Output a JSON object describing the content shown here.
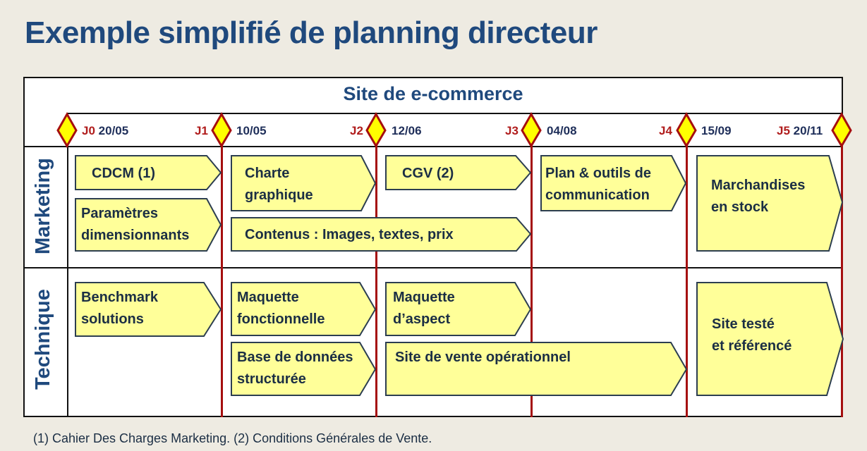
{
  "title": "Exemple simplifié de planning directeur",
  "project": "Site de e-commerce",
  "colors": {
    "title": "#1f497d",
    "milestone_fill": "#ffff00",
    "milestone_stroke": "#a50f0f",
    "task_fill": "#ffff99",
    "task_stroke": "#2c3e50",
    "milestone_line": "#a50f0f"
  },
  "milestones": [
    {
      "id": "J0",
      "date": "20/05"
    },
    {
      "id": "J1",
      "date": "10/05"
    },
    {
      "id": "J2",
      "date": "12/06"
    },
    {
      "id": "J3",
      "date": "04/08"
    },
    {
      "id": "J4",
      "date": "15/09"
    },
    {
      "id": "J5",
      "date": "20/11"
    }
  ],
  "lanes": [
    {
      "name": "Marketing",
      "tasks": [
        {
          "label": "CDCM (1)",
          "from": "J0",
          "to": "J1"
        },
        {
          "label": "Paramètres dimensionnants",
          "from": "J0",
          "to": "J1"
        },
        {
          "label": "Charte graphique",
          "from": "J1",
          "to": "J2"
        },
        {
          "label": "Contenus : Images, textes, prix",
          "from": "J1",
          "to": "J3"
        },
        {
          "label": "CGV (2)",
          "from": "J2",
          "to": "J3"
        },
        {
          "label": "Plan & outils de communication",
          "from": "J3",
          "to": "J4"
        },
        {
          "label": "Marchandises en stock",
          "from": "J4",
          "to": "J5"
        }
      ]
    },
    {
      "name": "Technique",
      "tasks": [
        {
          "label": "Benchmark solutions",
          "from": "J0",
          "to": "J1"
        },
        {
          "label": "Maquette fonctionnelle",
          "from": "J1",
          "to": "J2"
        },
        {
          "label": "Base de données structurée",
          "from": "J1",
          "to": "J2"
        },
        {
          "label": "Maquette d’aspect",
          "from": "J2",
          "to": "J3"
        },
        {
          "label": "Site de vente opérationnel",
          "from": "J2",
          "to": "J4"
        },
        {
          "label": "Site testé et référencé",
          "from": "J4",
          "to": "J5"
        }
      ]
    }
  ],
  "task_lines": {
    "cdcm": "CDCM (1)",
    "param1": "Paramètres",
    "param2": "dimensionnants",
    "charte1": "Charte",
    "charte2": "graphique",
    "contenus": "Contenus : Images, textes, prix",
    "cgv": "CGV (2)",
    "plan1": "Plan & outils de",
    "plan2": "communication",
    "march1": "Marchandises",
    "march2": "en stock",
    "bench1": "Benchmark",
    "bench2": "solutions",
    "mf1": "Maquette",
    "mf2": "fonctionnelle",
    "bdd1": "Base de données",
    "bdd2": "structurée",
    "ma1": "Maquette",
    "ma2": "d’aspect",
    "svo": "Site de vente opérationnel",
    "st1": "Site testé",
    "st2": "et référencé"
  },
  "footnote": "(1) Cahier Des Charges Marketing.  (2) Conditions Générales de Vente."
}
